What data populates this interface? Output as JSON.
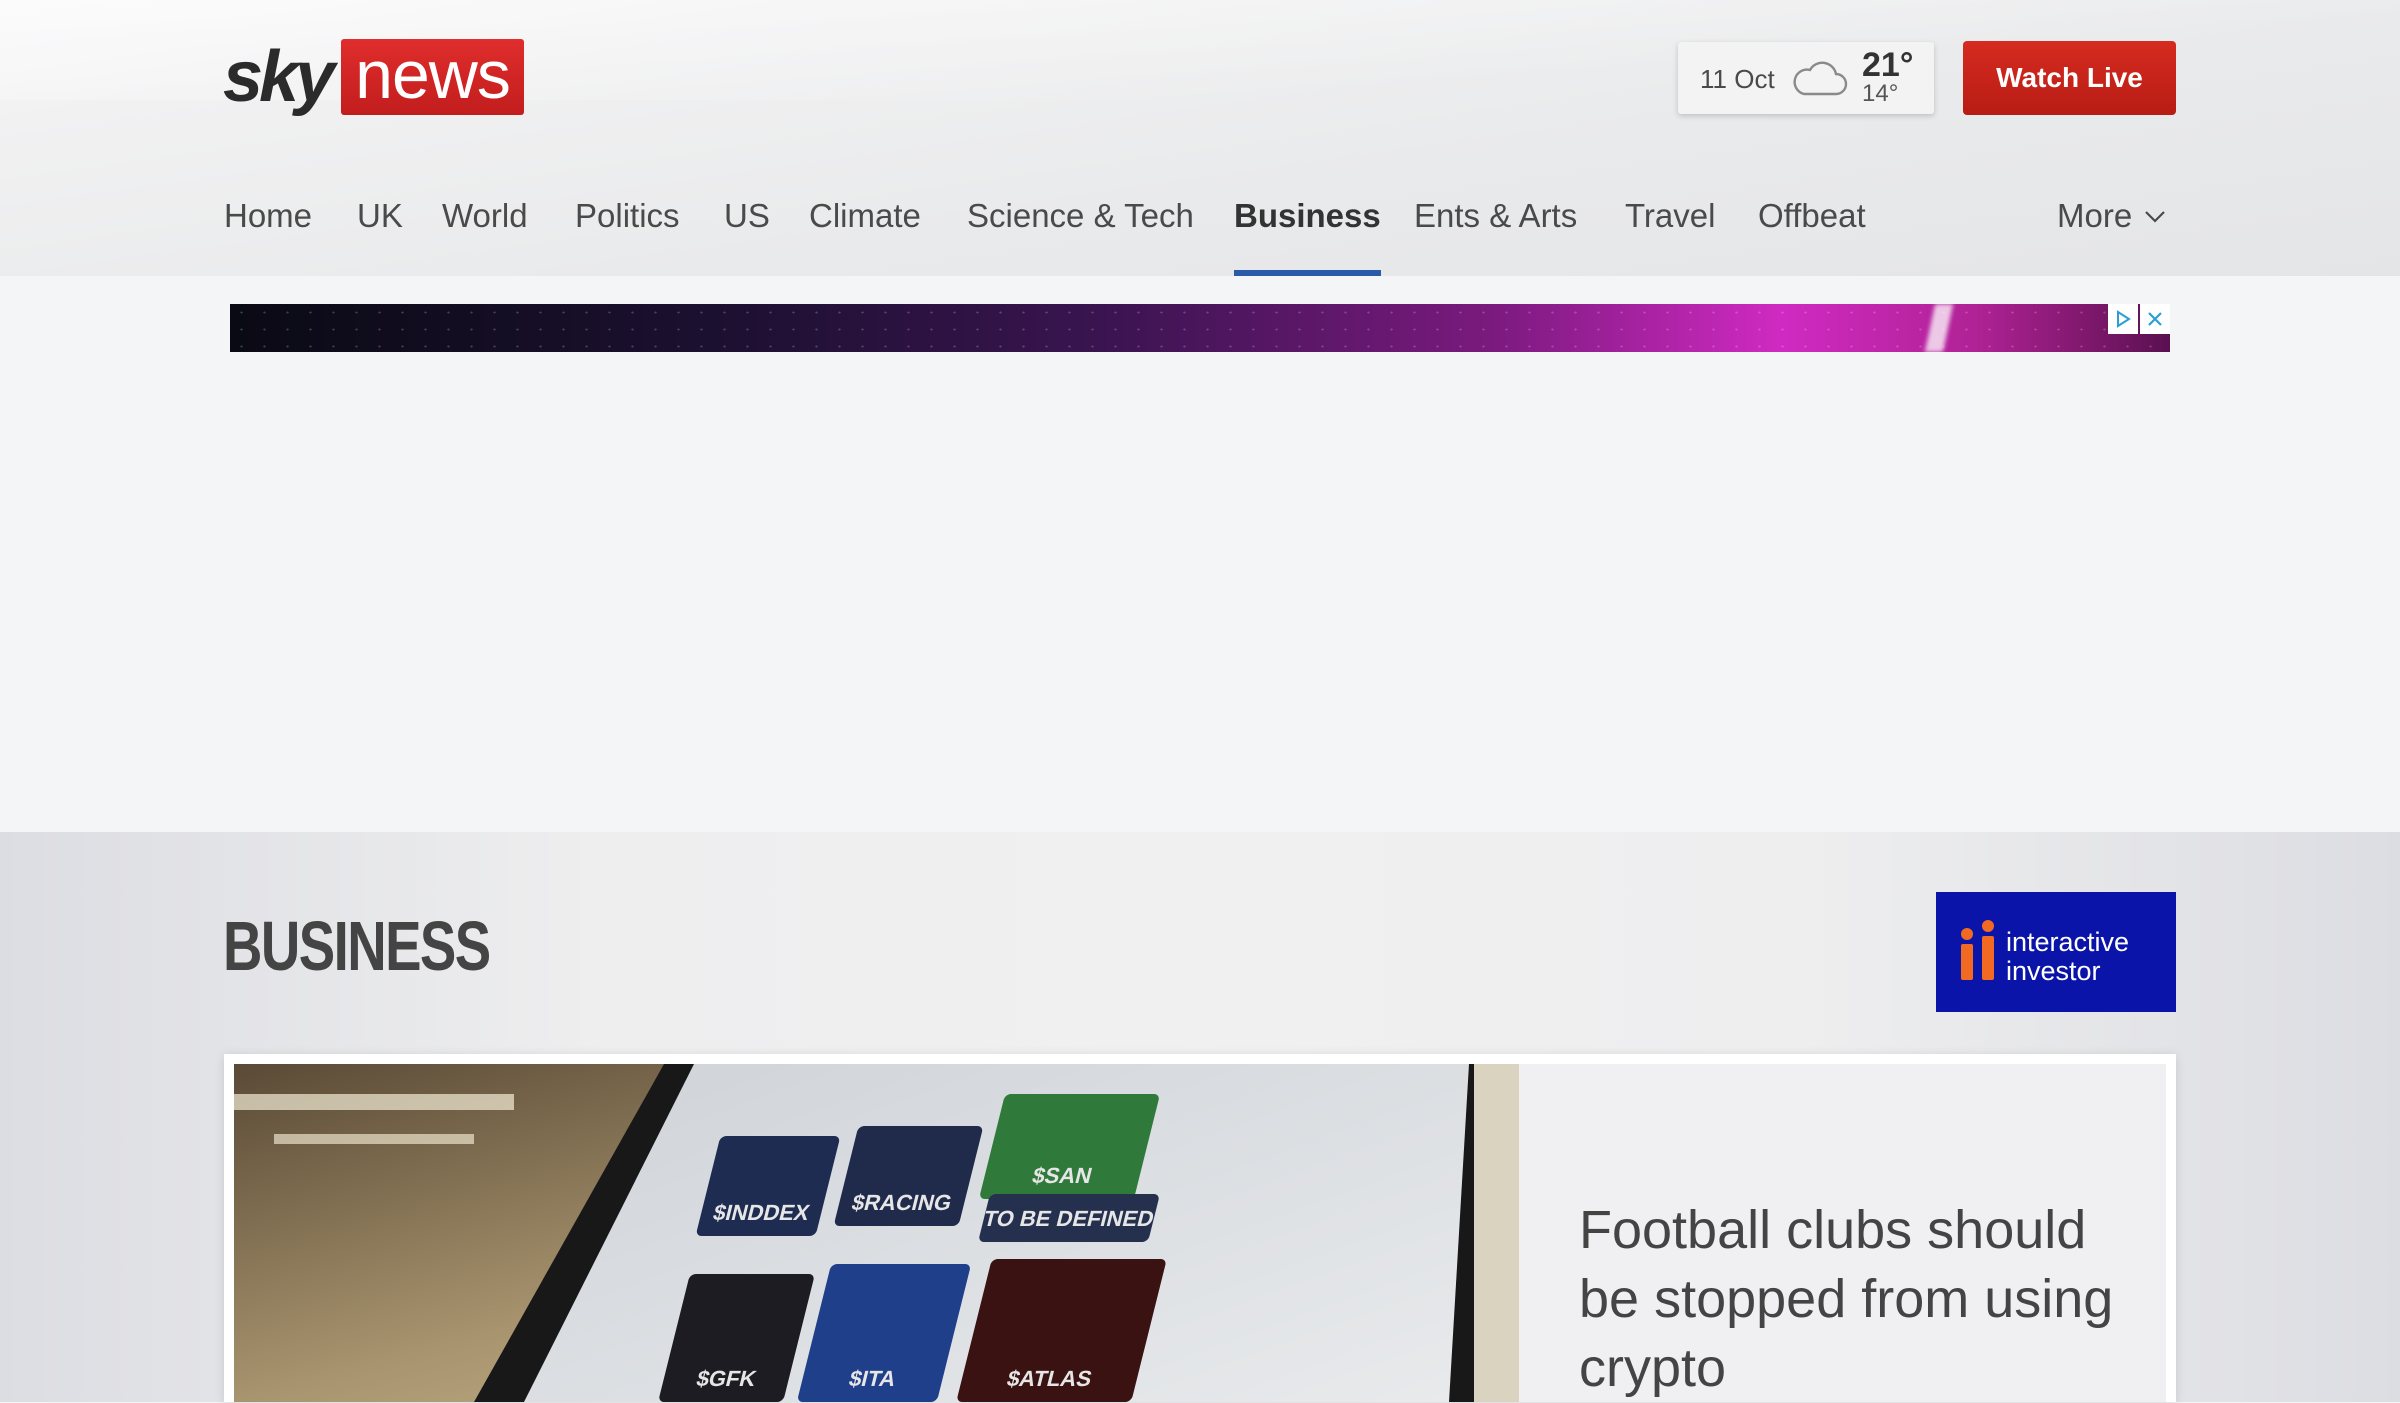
{
  "header": {
    "logo": {
      "sky": "sky",
      "news": "news"
    },
    "weather": {
      "date": "11 Oct",
      "icon": "cloud-icon",
      "high": "21°",
      "low": "14°"
    },
    "watch_live_label": "Watch Live"
  },
  "nav": {
    "items": [
      {
        "label": "Home"
      },
      {
        "label": "UK"
      },
      {
        "label": "World"
      },
      {
        "label": "Politics"
      },
      {
        "label": "US"
      },
      {
        "label": "Climate"
      },
      {
        "label": "Science & Tech"
      },
      {
        "label": "Business",
        "active": true
      },
      {
        "label": "Ents & Arts"
      },
      {
        "label": "Travel"
      },
      {
        "label": "Offbeat"
      }
    ],
    "more_label": "More"
  },
  "ad": {
    "icons": [
      "adchoices-icon",
      "close-icon"
    ]
  },
  "section": {
    "title": "BUSINESS",
    "sponsor": {
      "line1": "interactive",
      "line2": "investor"
    }
  },
  "lead_story": {
    "headline": "Football clubs should be stopped from using crypto",
    "image_cards": [
      "$INDDEX",
      "$RACING",
      "$SAN",
      "TO BE DEFINED",
      "$GFK",
      "$ITA",
      "$ATLAS"
    ]
  },
  "colors": {
    "brand_red": "#c8211a",
    "nav_active": "#2a5aa8",
    "sponsor_blue": "#0b14a8",
    "sponsor_orange": "#f26a21"
  }
}
